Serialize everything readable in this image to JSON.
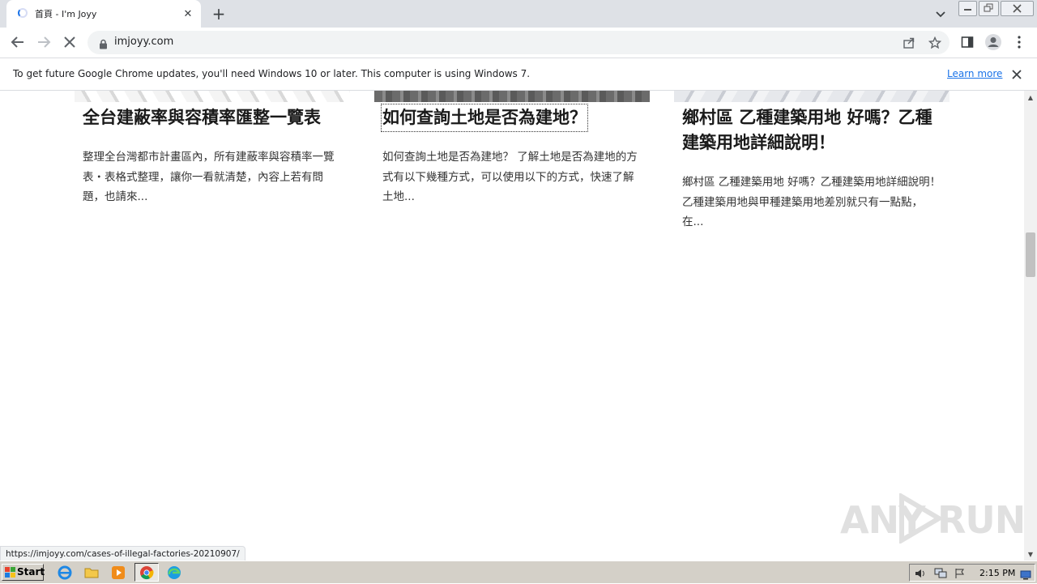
{
  "tab": {
    "title": "首頁 - I'm Joyy",
    "close": "✕",
    "new_tab": "+"
  },
  "toolbar": {
    "url": "imjoyy.com"
  },
  "infobar": {
    "message": "To get future Google Chrome updates, you'll need Windows 10 or later. This computer is using Windows 7.",
    "link": "Learn more"
  },
  "cards": [
    {
      "title": "全台建蔽率與容積率匯整一覽表",
      "excerpt": "整理全台灣都市計畫區內，所有建蔽率與容積率一覽表・表格式整理，讓你一看就清楚，內容上若有問題，也請來..."
    },
    {
      "title": "如何查詢土地是否為建地？",
      "excerpt": "如何查詢土地是否為建地？ 了解土地是否為建地的方式有以下幾種方式，可以使用以下的方式，快速了解土地..."
    },
    {
      "title": "鄉村區 乙種建築用地 好嗎？乙種建築用地詳細說明！",
      "excerpt": "鄉村區 乙種建築用地 好嗎？乙種建築用地詳細說明！乙種建築用地與甲種建築用地差別就只有一點點，在..."
    }
  ],
  "status_url": "https://imjoyy.com/cases-of-illegal-factories-20210907/",
  "watermark": {
    "left": "ANY",
    "right": "RUN"
  },
  "taskbar": {
    "start": "Start",
    "time": "2:15 PM"
  },
  "colors": {
    "accent": "#1a73e8",
    "tabstrip": "#dee1e6",
    "taskbar": "#d4d0c8"
  }
}
